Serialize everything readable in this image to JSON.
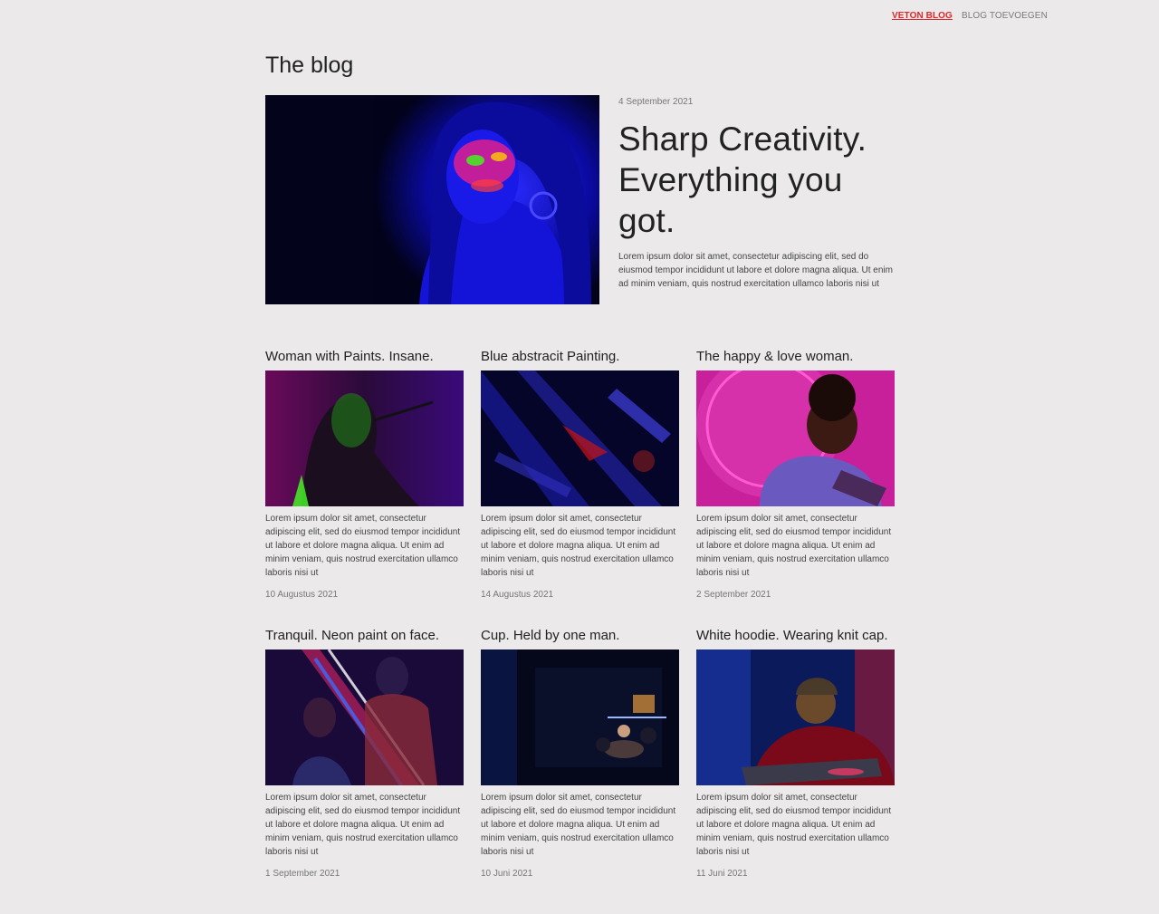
{
  "nav": {
    "items": [
      {
        "label": "VETON BLOG"
      },
      {
        "label": "BLOG TOEVOEGEN"
      }
    ],
    "active_color": "#e0262b"
  },
  "page": {
    "title": "The blog"
  },
  "hero": {
    "date": "4 September 2021",
    "title": "Sharp Creativity. Everything you got.",
    "excerpt": "Lorem ipsum dolor sit amet, consectetur adipiscing elit, sed do eiusmod tempor incididunt ut labore et dolore magna aliqua. Ut enim ad minim veniam, quis nostrud exercitation ullamco laboris nisi ut",
    "image": "neon-face-paint-photo"
  },
  "posts": [
    {
      "title": "Woman with Paints. Insane.",
      "excerpt": "Lorem ipsum dolor sit amet, consectetur adipiscing elit, sed do eiusmod tempor incididunt ut labore et dolore magna aliqua. Ut enim ad minim veniam, quis nostrud exercitation ullamco laboris nisi ut",
      "date": "10 Augustus 2021",
      "image": "woman-neon-paint-photo"
    },
    {
      "title": "Blue abstracit Painting.",
      "excerpt": "Lorem ipsum dolor sit amet, consectetur adipiscing elit, sed do eiusmod tempor incididunt ut labore et dolore magna aliqua. Ut enim ad minim veniam, quis nostrud exercitation ullamco laboris nisi ut",
      "date": "14 Augustus 2021",
      "image": "blue-abstract-photo"
    },
    {
      "title": "The happy & love woman.",
      "excerpt": "Lorem ipsum dolor sit amet, consectetur adipiscing elit, sed do eiusmod tempor incididunt ut labore et dolore magna aliqua. Ut enim ad minim veniam, quis nostrud exercitation ullamco laboris nisi ut",
      "date": "2 September 2021",
      "image": "pink-woman-photo"
    },
    {
      "title": "Tranquil. Neon paint on face.",
      "excerpt": "Lorem ipsum dolor sit amet, consectetur adipiscing elit, sed do eiusmod tempor incididunt ut labore et dolore magna aliqua. Ut enim ad minim veniam, quis nostrud exercitation ullamco laboris nisi ut",
      "date": "1 September 2021",
      "image": "neon-tubes-photo"
    },
    {
      "title": "Cup. Held by one man.",
      "excerpt": "Lorem ipsum dolor sit amet, consectetur adipiscing elit, sed do eiusmod tempor incididunt ut labore et dolore magna aliqua. Ut enim ad minim veniam, quis nostrud exercitation ullamco laboris nisi ut",
      "date": "10 Juni 2021",
      "image": "dark-room-photo"
    },
    {
      "title": "White hoodie. Wearing knit cap.",
      "excerpt": "Lorem ipsum dolor sit amet, consectetur adipiscing elit, sed do eiusmod tempor incididunt ut labore et dolore magna aliqua. Ut enim ad minim veniam, quis nostrud exercitation ullamco laboris nisi ut",
      "date": "11 Juni 2021",
      "image": "knit-cap-man-photo"
    }
  ]
}
